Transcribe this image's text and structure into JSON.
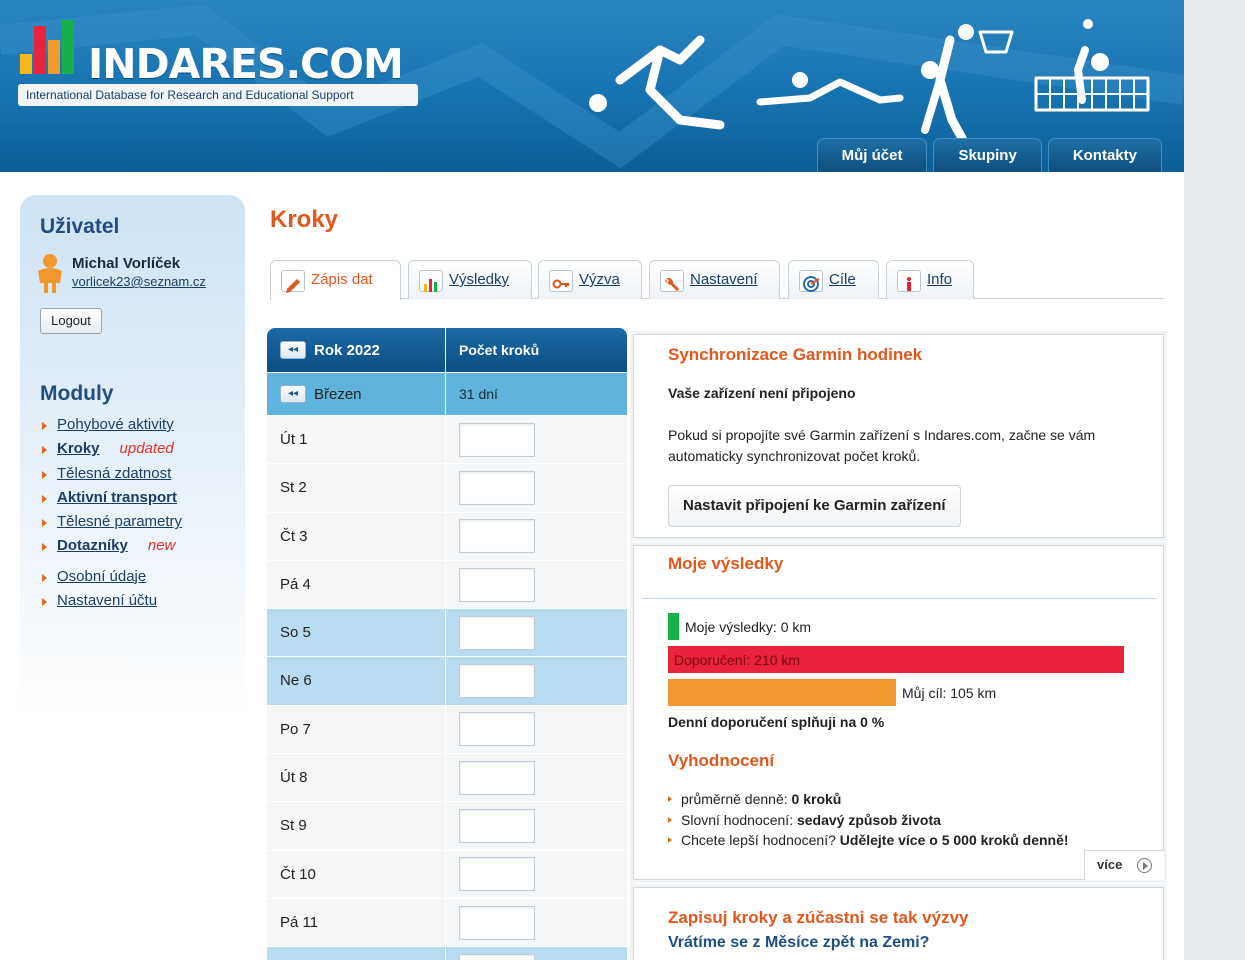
{
  "brand": {
    "title": "INDARES.COM",
    "subtitle": "International Database for Research and Educational Support"
  },
  "topnav": [
    "Můj účet",
    "Skupiny",
    "Kontakty"
  ],
  "sidebar": {
    "user_heading": "Uživatel",
    "user_name": "Michal Vorlíček",
    "user_email": "vorlicek23@seznam.cz",
    "logout": "Logout",
    "modules_heading": "Moduly",
    "modules": [
      {
        "label": "Pohybové aktivity",
        "tag": ""
      },
      {
        "label": "Kroky",
        "tag": "updated"
      },
      {
        "label": "Tělesná zdatnost",
        "tag": ""
      },
      {
        "label": "Aktivní transport",
        "tag": ""
      },
      {
        "label": "Tělesné parametry",
        "tag": ""
      },
      {
        "label": "Dotazníky",
        "tag": "new"
      },
      {
        "label": "Osobní údaje",
        "tag": ""
      },
      {
        "label": "Nastavení účtu",
        "tag": ""
      }
    ]
  },
  "main": {
    "title": "Kroky",
    "tabs": [
      "Zápis dat",
      "Výsledky",
      "Výzva",
      "Nastavení",
      "Cíle",
      "Info"
    ]
  },
  "steps_table": {
    "year_label": "Rok 2022",
    "count_header": "Počet kroků",
    "month_label": "Březen",
    "month_days": "31 dní",
    "days": [
      {
        "label": "Út 1",
        "weekend": false
      },
      {
        "label": "St 2",
        "weekend": false
      },
      {
        "label": "Čt 3",
        "weekend": false
      },
      {
        "label": "Pá 4",
        "weekend": false
      },
      {
        "label": "So 5",
        "weekend": true
      },
      {
        "label": "Ne 6",
        "weekend": true
      },
      {
        "label": "Po 7",
        "weekend": false
      },
      {
        "label": "Út 8",
        "weekend": false
      },
      {
        "label": "St 9",
        "weekend": false
      },
      {
        "label": "Čt 10",
        "weekend": false
      },
      {
        "label": "Pá 11",
        "weekend": false
      },
      {
        "label": "",
        "weekend": true
      }
    ]
  },
  "garmin": {
    "title": "Synchronizace Garmin hodinek",
    "status": "Vaše zařízení není připojeno",
    "text": "Pokud si propojíte své Garmin zařízení s Indares.com, začne se vám automaticky synchronizovat počet kroků.",
    "button": "Nastavit připojení ke Garmin zařízení"
  },
  "results": {
    "title": "Moje výsledky",
    "mine_label": "Moje výsledky: 0 km",
    "mine_km": 0,
    "recommended_label": "Doporučení: 210 km",
    "recommended_km": 210,
    "goal_label": "Můj cíl: 105 km",
    "goal_km": 105,
    "summary": "Denní doporučení splňuji na 0 %",
    "eval_heading": "Vyhodnocení",
    "evals": [
      {
        "label": "průměrně denně: ",
        "value": "0 kroků"
      },
      {
        "label": "Slovní hodnocení: ",
        "value": "sedavý způsob života"
      },
      {
        "label": "Chcete lepší hodnocení? ",
        "value": "Udělejte více o 5 000 kroků denně!"
      }
    ],
    "more": "více",
    "colors": {
      "mine": "#18b04a",
      "recommended": "#e8233a",
      "goal": "#f3972f"
    }
  },
  "challenge": {
    "title": "Zapisuj kroky a zúčastni se tak výzvy",
    "subtitle": "Vrátíme se z Měsíce zpět na Zemi?"
  }
}
